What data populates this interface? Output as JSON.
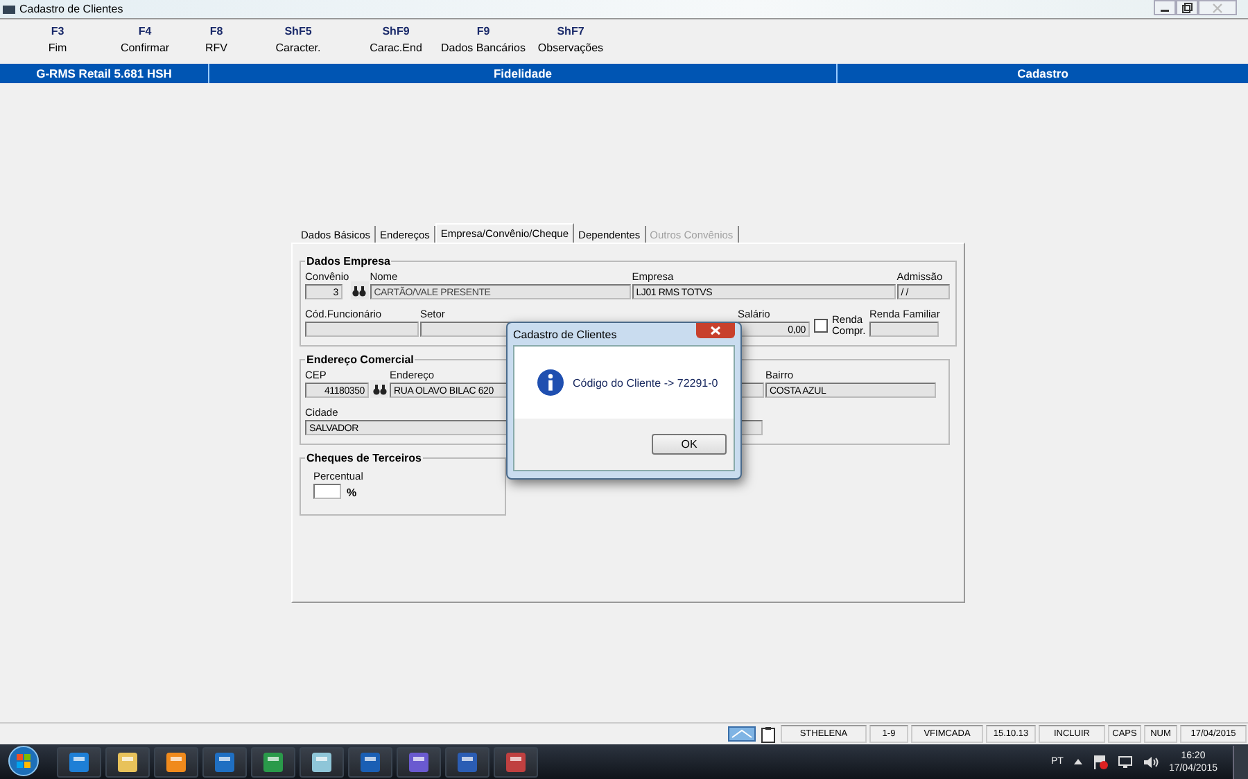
{
  "window": {
    "title": "Cadastro de Clientes"
  },
  "toolbar": [
    {
      "key": "F3",
      "label": "Fim"
    },
    {
      "key": "F4",
      "label": "Confirmar"
    },
    {
      "key": "F8",
      "label": "RFV"
    },
    {
      "key": "ShF5",
      "label": "Caracter."
    },
    {
      "key": "ShF9",
      "label": "Carac.End"
    },
    {
      "key": "F9",
      "label": "Dados Bancários"
    },
    {
      "key": "ShF7",
      "label": "Observações"
    }
  ],
  "header_bar": [
    "G-RMS Retail 5.681 HSH",
    "Fidelidade",
    "Cadastro"
  ],
  "tabs": [
    {
      "label": "Dados Básicos",
      "selected": false,
      "disabled": false
    },
    {
      "label": "Endereços",
      "selected": false,
      "disabled": false
    },
    {
      "label": "Empresa/Convênio/Cheque",
      "selected": true,
      "disabled": false
    },
    {
      "label": "Dependentes",
      "selected": false,
      "disabled": false
    },
    {
      "label": "Outros Convênios",
      "selected": false,
      "disabled": true
    }
  ],
  "dados_empresa": {
    "title": "Dados Empresa",
    "convenio": {
      "label": "Convênio",
      "value": "3"
    },
    "nome": {
      "label": "Nome",
      "value": "CARTÃO/VALE PRESENTE"
    },
    "empresa": {
      "label": "Empresa",
      "value": "LJ01 RMS TOTVS"
    },
    "admissao": {
      "label": "Admissão",
      "value": "/ /"
    },
    "cod_funcionario": {
      "label": "Cód.Funcionário"
    },
    "setor": {
      "label": "Setor"
    },
    "salario": {
      "label": "Salário",
      "value": "0,00"
    },
    "renda_compr": {
      "label": "Renda Compr.",
      "checked": false
    },
    "renda_familiar": {
      "label": "Renda Familiar"
    }
  },
  "endereco_comercial": {
    "title": "Endereço Comercial",
    "cep": {
      "label": "CEP",
      "value": "41180350"
    },
    "endereco": {
      "label": "Endereço",
      "value": "RUA OLAVO BILAC 620"
    },
    "bairro": {
      "label": "Bairro",
      "value": "COSTA AZUL"
    },
    "cidade": {
      "label": "Cidade",
      "value": "SALVADOR"
    }
  },
  "cheques": {
    "title": "Cheques de Terceiros",
    "percentual": {
      "label": "Percentual"
    },
    "unit": "%"
  },
  "dialog": {
    "title": "Cadastro de Clientes",
    "message": "Código do Cliente -> 72291-0",
    "button": "OK"
  },
  "status_bar": [
    "STHELENA",
    "1-9",
    "VFIMCADA",
    "15.10.13",
    "INCLUIR",
    "CAPS",
    "NUM",
    "17/04/2015"
  ],
  "tray": {
    "language": "PT",
    "time": "16:20",
    "date": "17/04/2015"
  }
}
